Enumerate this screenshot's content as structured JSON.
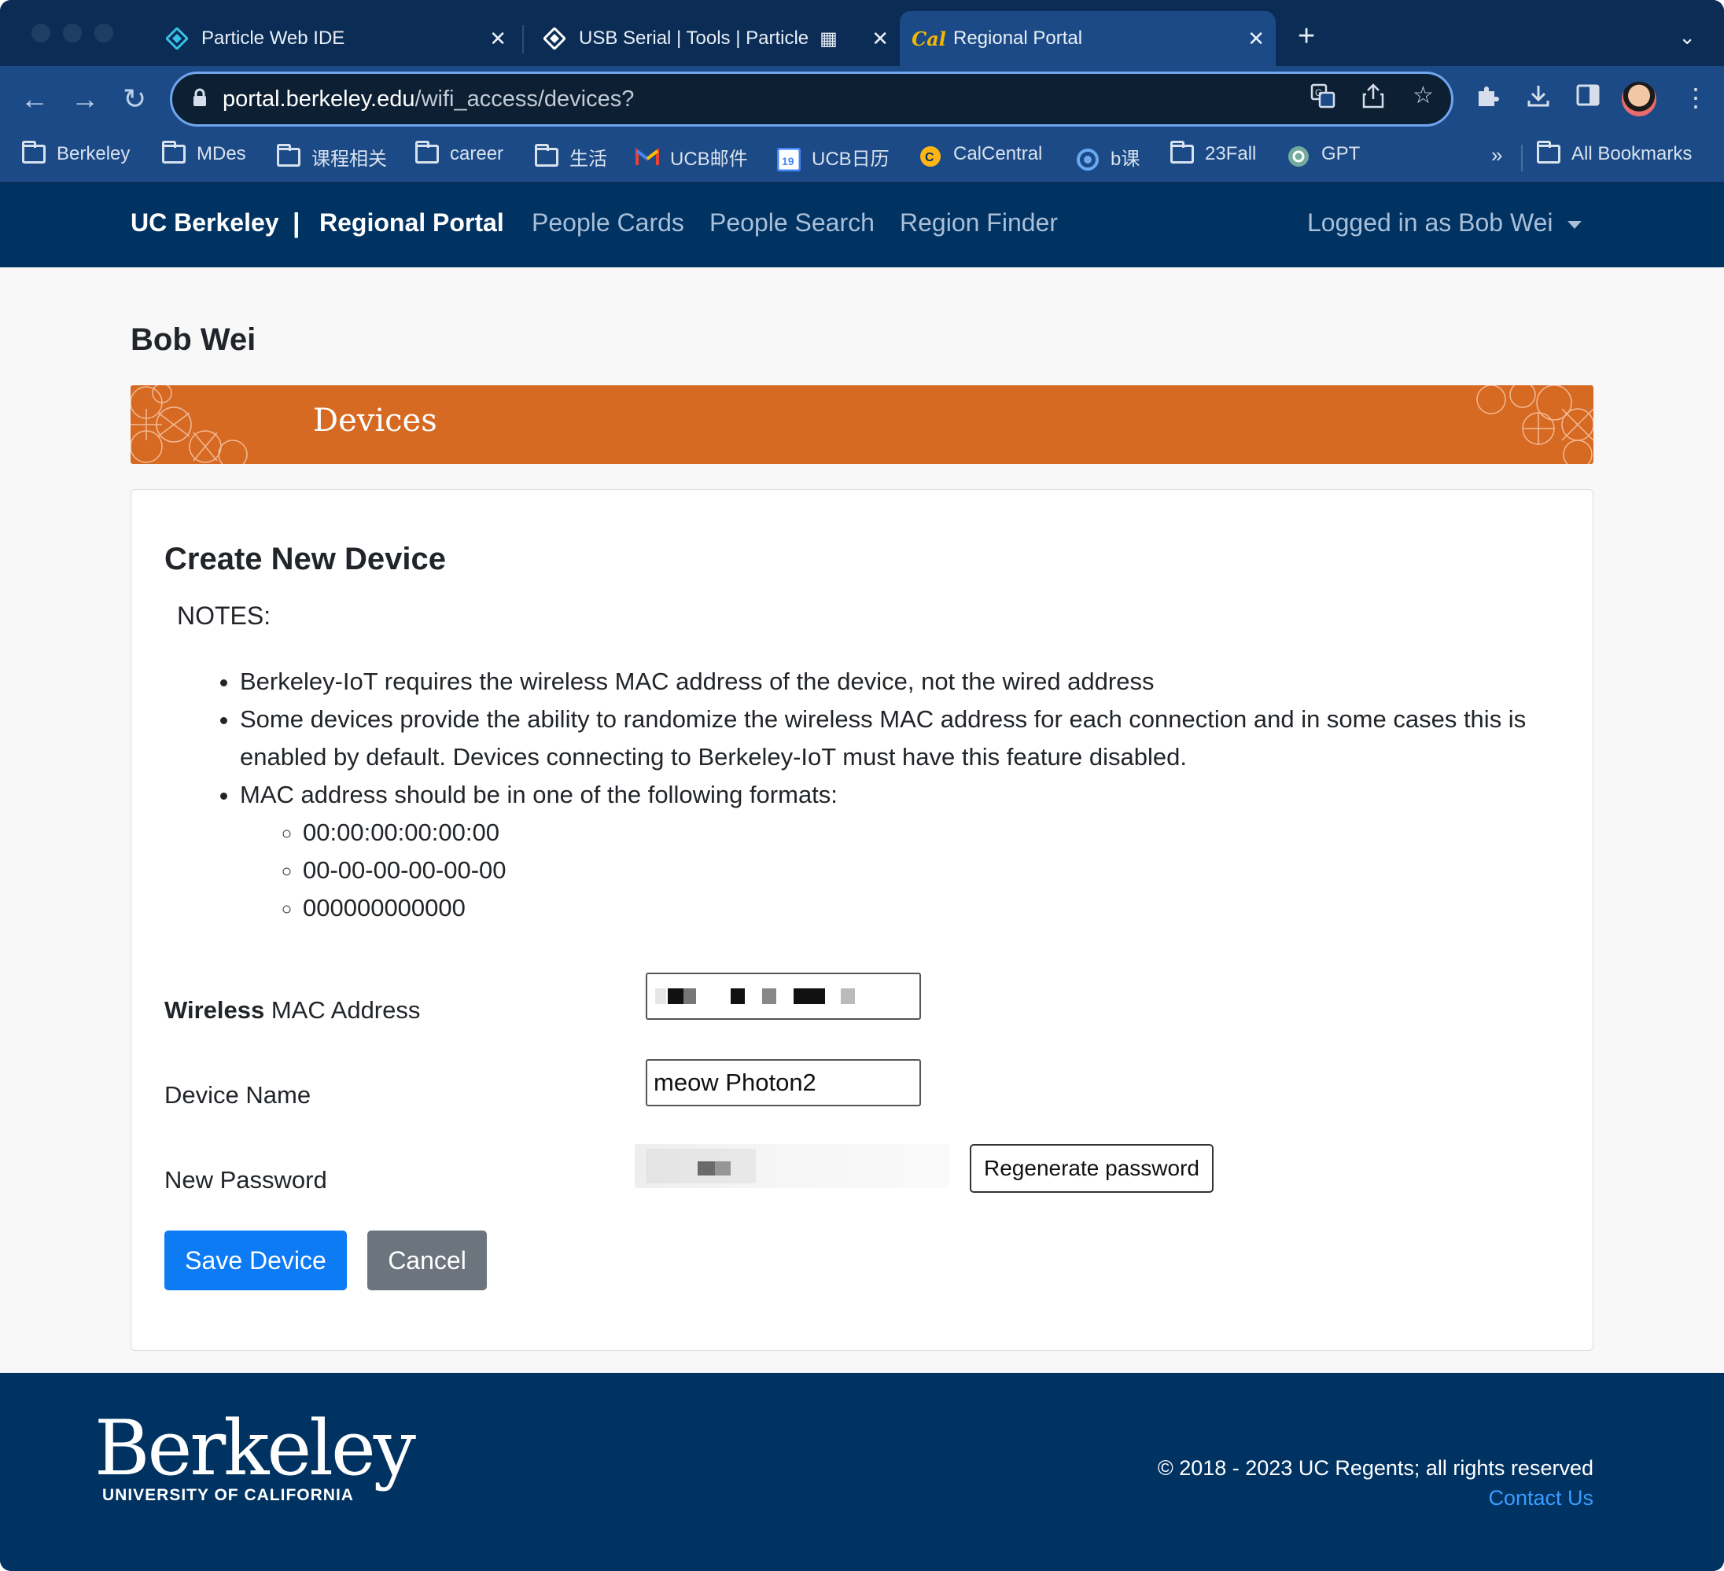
{
  "browser": {
    "tabs": [
      {
        "title": "Particle Web IDE",
        "active": false,
        "icon": "particle-icon"
      },
      {
        "title": "USB Serial | Tools | Particle",
        "active": false,
        "icon": "particle-icon"
      },
      {
        "title": "Regional Portal",
        "active": true,
        "icon": "cal-icon"
      }
    ],
    "new_tab": "+",
    "url_host": "portal.berkeley.edu",
    "url_path": "/wifi_access/devices?",
    "bookmarks": [
      {
        "label": "Berkeley",
        "icon": "folder-icon"
      },
      {
        "label": "MDes",
        "icon": "folder-icon"
      },
      {
        "label": "课程相关",
        "icon": "folder-icon"
      },
      {
        "label": "career",
        "icon": "folder-icon"
      },
      {
        "label": "生活",
        "icon": "folder-icon"
      },
      {
        "label": "UCB邮件",
        "icon": "gmail-icon"
      },
      {
        "label": "UCB日历",
        "icon": "calendar-icon"
      },
      {
        "label": "CalCentral",
        "icon": "calcentral-icon"
      },
      {
        "label": "b课",
        "icon": "b-icon"
      },
      {
        "label": "23Fall",
        "icon": "folder-icon"
      },
      {
        "label": "GPT",
        "icon": "openai-icon"
      }
    ],
    "bookmarks_overflow": "»",
    "all_bookmarks": "All Bookmarks"
  },
  "header": {
    "brand": "UC Berkeley",
    "separator": "|",
    "portal": "Regional Portal",
    "nav": [
      "People Cards",
      "People Search",
      "Region Finder"
    ],
    "user": "Logged in as Bob Wei"
  },
  "main": {
    "person_name": "Bob Wei",
    "banner_title": "Devices",
    "form": {
      "heading": "Create New Device",
      "notes_title": "NOTES:",
      "notes": [
        "Berkeley-IoT requires the wireless MAC address of the device, not the wired address",
        "Some devices provide the ability to randomize the wireless MAC address for each connection and in some cases this is enabled by default. Devices connecting to Berkeley-IoT must have this feature disabled.",
        "MAC address should be in one of the following formats:"
      ],
      "formats": [
        "00:00:00:00:00:00",
        "00-00-00-00-00-00",
        "000000000000"
      ],
      "mac_label_bold": "Wireless",
      "mac_label_rest": " MAC Address",
      "device_name_label": "Device Name",
      "device_name_value": "meow Photon2",
      "password_label": "New Password",
      "regenerate_label": "Regenerate password",
      "save_label": "Save Device",
      "cancel_label": "Cancel"
    }
  },
  "footer": {
    "logo_word": "Berkeley",
    "logo_sub": "UNIVERSITY OF CALIFORNIA",
    "copyright": "© 2018 - 2023 UC Regents; all rights reserved",
    "contact": "Contact Us"
  },
  "colors": {
    "berkeley_blue": "#003262",
    "banner_orange": "#d66a23",
    "primary_button": "#0d7bf4",
    "secondary_button": "#6c757d",
    "link": "#3b9cff"
  }
}
